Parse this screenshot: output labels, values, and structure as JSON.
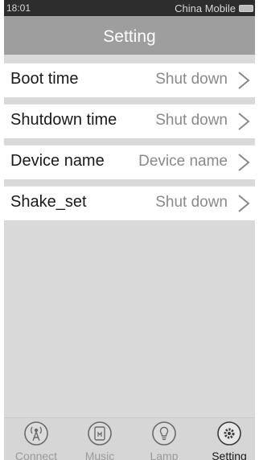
{
  "status": {
    "time": "18:01",
    "icons": "… ✱ ✕ ◷ ◔ .ıll",
    "carrier": "China Mobile"
  },
  "header": {
    "title": "Setting"
  },
  "settings": [
    {
      "label": "Boot time",
      "value": "Shut down"
    },
    {
      "label": "Shutdown time",
      "value": "Shut down"
    },
    {
      "label": "Device name",
      "value": "Device name"
    },
    {
      "label": "Shake_set",
      "value": "Shut down"
    }
  ],
  "tabs": [
    {
      "label": "Connect",
      "icon": "antenna-icon"
    },
    {
      "label": "Music",
      "icon": "music-icon"
    },
    {
      "label": "Lamp",
      "icon": "bulb-icon"
    },
    {
      "label": "Setting",
      "icon": "gear-icon",
      "active": true
    }
  ],
  "colors": {
    "header_bg": "#9e9e9e",
    "list_bg": "#d9d9d9",
    "status_bg": "#2d2d2d"
  }
}
